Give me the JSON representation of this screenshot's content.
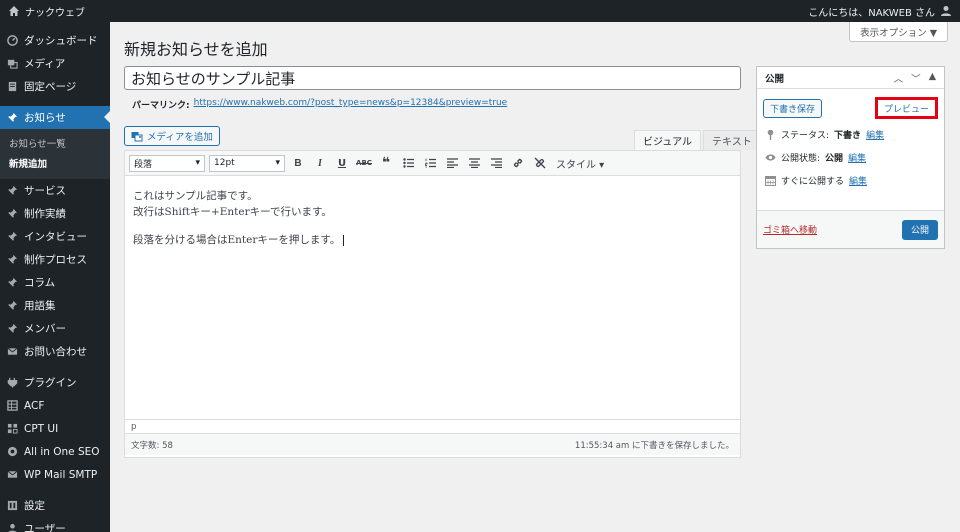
{
  "adminbar": {
    "site_name": "ナックウェブ",
    "greeting": "こんにちは、NAKWEB さん"
  },
  "sidebar": {
    "items": [
      {
        "label": "ダッシュボード",
        "icon": "dashboard-icon"
      },
      {
        "label": "メディア",
        "icon": "media-icon"
      },
      {
        "label": "固定ページ",
        "icon": "page-icon"
      },
      {
        "label": "お知らせ",
        "icon": "pin-icon"
      },
      {
        "label": "サービス",
        "icon": "pin-icon"
      },
      {
        "label": "制作実績",
        "icon": "pin-icon"
      },
      {
        "label": "インタビュー",
        "icon": "pin-icon"
      },
      {
        "label": "制作プロセス",
        "icon": "pin-icon"
      },
      {
        "label": "コラム",
        "icon": "pin-icon"
      },
      {
        "label": "用語集",
        "icon": "pin-icon"
      },
      {
        "label": "メンバー",
        "icon": "pin-icon"
      },
      {
        "label": "お問い合わせ",
        "icon": "mail-icon"
      },
      {
        "label": "プラグイン",
        "icon": "plugin-icon"
      },
      {
        "label": "ACF",
        "icon": "grid-icon"
      },
      {
        "label": "CPT UI",
        "icon": "grid-icon"
      },
      {
        "label": "All in One SEO",
        "icon": "seo-icon"
      },
      {
        "label": "WP Mail SMTP",
        "icon": "mail-icon"
      },
      {
        "label": "設定",
        "icon": "settings-icon"
      },
      {
        "label": "ユーザー",
        "icon": "user-icon"
      }
    ],
    "submenu": [
      "お知らせ一覧",
      "新規追加"
    ]
  },
  "header": {
    "title": "新規お知らせを追加",
    "screen_options": "表示オプション ▼"
  },
  "post": {
    "title": "お知らせのサンプル記事",
    "permalink_label": "パーマリンク:",
    "permalink_url": "https://www.nakweb.com/?post_type=news&p=12384&preview=true"
  },
  "editor": {
    "add_media": "メディアを追加",
    "tab_visual": "ビジュアル",
    "tab_text": "テキスト",
    "format_select": "段落",
    "size_select": "12pt",
    "style_label": "スタイル ▾",
    "line1": "これはサンプル記事です。",
    "line2": "改行はShiftキー+Enterキーで行います。",
    "line3": "段落を分ける場合はEnterキーを押します。",
    "path": "p",
    "word_count": "文字数: 58",
    "saved_status": "11:55:34 am に下書きを保存しました。"
  },
  "publish": {
    "title": "公開",
    "save_draft": "下書き保存",
    "preview": "プレビュー",
    "status_label": "ステータス:",
    "status_value": "下書き",
    "visibility_label": "公開状態:",
    "visibility_value": "公開",
    "schedule_label": "すぐに公開する",
    "edit": "編集",
    "trash": "ゴミ箱へ移動",
    "publish_button": "公開"
  },
  "colors": {
    "accent": "#2271b1",
    "highlight": "#e60012",
    "sidebar_bg": "#1d2327"
  }
}
